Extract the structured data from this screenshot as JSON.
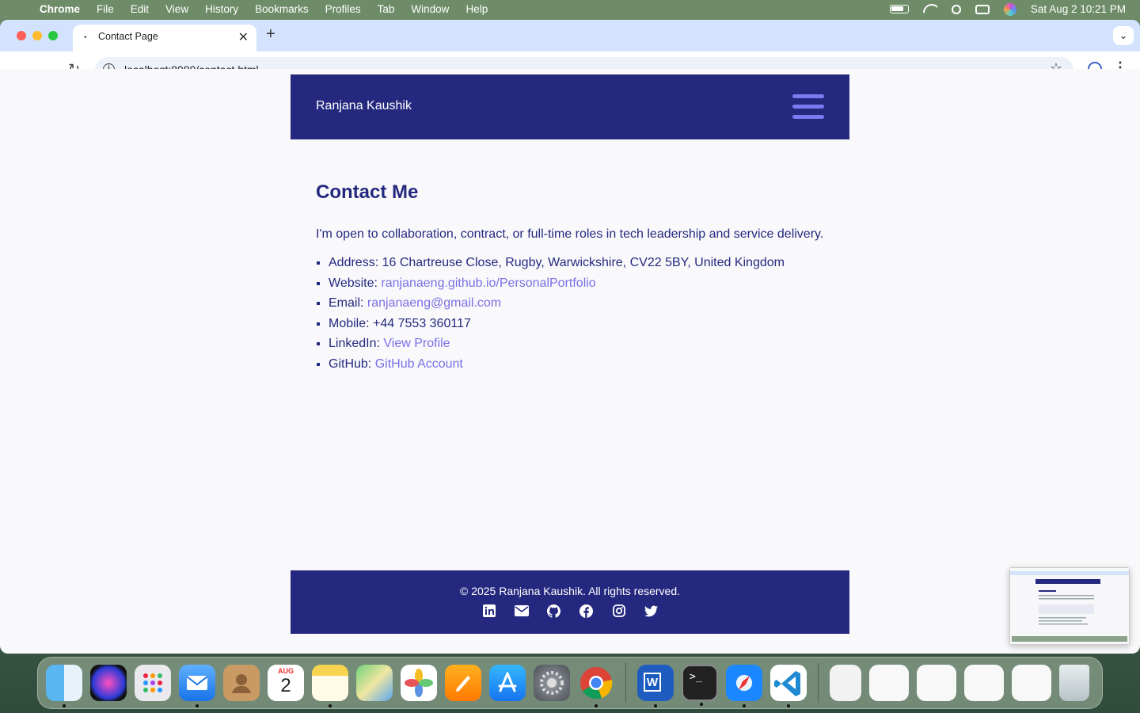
{
  "menubar": {
    "app": "Chrome",
    "items": [
      "File",
      "Edit",
      "View",
      "History",
      "Bookmarks",
      "Profiles",
      "Tab",
      "Window",
      "Help"
    ],
    "datetime": "Sat Aug 2  10:21 PM"
  },
  "browser": {
    "tab_title": "Contact Page",
    "url": "localhost:8080/contact.html"
  },
  "site": {
    "brand": "Ranjana Kaushik",
    "heading": "Contact Me",
    "intro": "I'm open to collaboration, contract, or full-time roles in tech leadership and service delivery.",
    "contacts": [
      {
        "label": "Address:",
        "value": "16 Chartreuse Close, Rugby, Warwickshire, CV22 5BY, United Kingdom"
      },
      {
        "label": "Website:",
        "link": "ranjanaeng.github.io/PersonalPortfolio"
      },
      {
        "label": "Email:",
        "link": "ranjanaeng@gmail.com"
      },
      {
        "label": "Mobile:",
        "value": "+44 7553 360117"
      },
      {
        "label": "LinkedIn:",
        "link": "View Profile"
      },
      {
        "label": "GitHub:",
        "link": "GitHub Account"
      }
    ],
    "footer": "© 2025 Ranjana Kaushik. All rights reserved."
  },
  "dock": {
    "calendar_month": "AUG",
    "calendar_day": "2"
  },
  "colors": {
    "brand_navy": "#24297f",
    "link": "#7a6fe6",
    "hamburger": "#7a7bf0"
  }
}
